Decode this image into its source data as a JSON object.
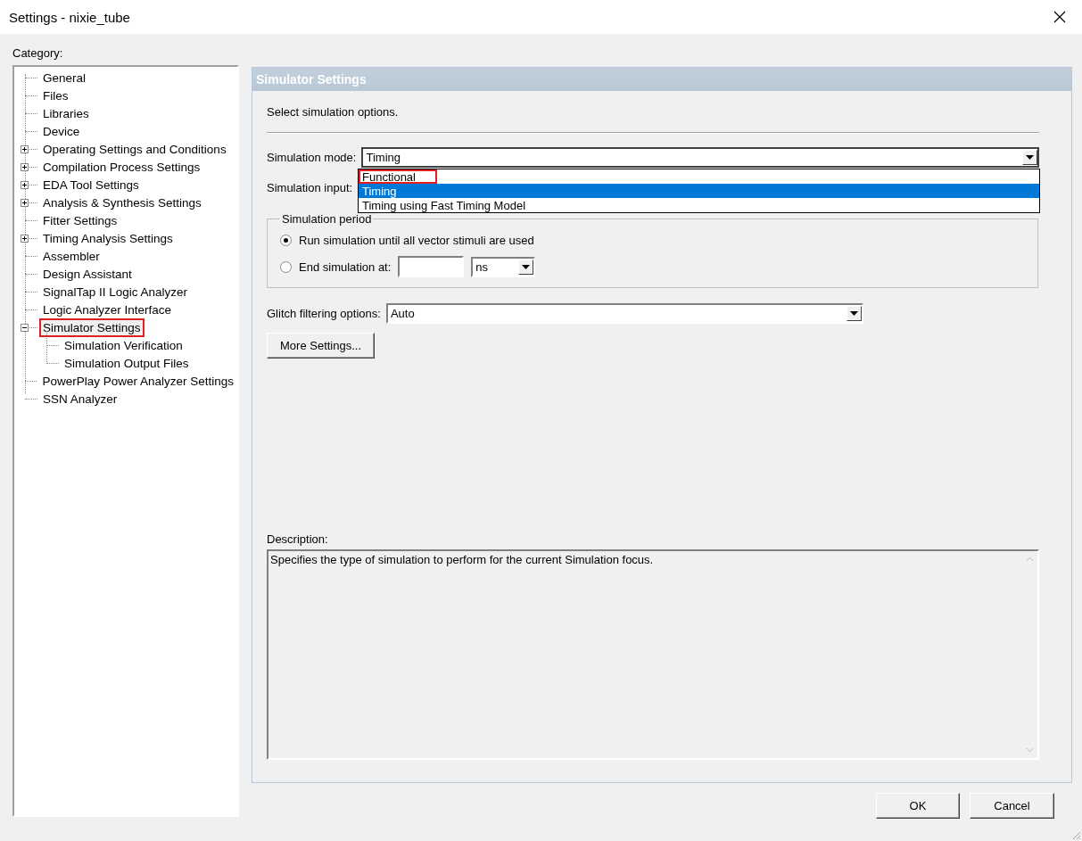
{
  "window": {
    "title": "Settings - nixie_tube"
  },
  "category": {
    "label": "Category:",
    "items": [
      {
        "label": "General",
        "selected": false,
        "annotated": false
      },
      {
        "label": "Files",
        "selected": false,
        "annotated": false
      },
      {
        "label": "Libraries",
        "selected": false,
        "annotated": false
      },
      {
        "label": "Device",
        "selected": false,
        "annotated": false
      },
      {
        "label": "Operating Settings and Conditions",
        "selected": false,
        "annotated": false,
        "expanded": false
      },
      {
        "label": "Compilation Process Settings",
        "selected": false,
        "annotated": false,
        "expanded": false
      },
      {
        "label": "EDA Tool Settings",
        "selected": false,
        "annotated": false,
        "expanded": false
      },
      {
        "label": "Analysis & Synthesis Settings",
        "selected": false,
        "annotated": false,
        "expanded": false
      },
      {
        "label": "Fitter Settings",
        "selected": false,
        "annotated": false
      },
      {
        "label": "Timing Analysis Settings",
        "selected": false,
        "annotated": false,
        "expanded": false
      },
      {
        "label": "Assembler",
        "selected": false,
        "annotated": false
      },
      {
        "label": "Design Assistant",
        "selected": false,
        "annotated": false
      },
      {
        "label": "SignalTap II Logic Analyzer",
        "selected": false,
        "annotated": false
      },
      {
        "label": "Logic Analyzer Interface",
        "selected": false,
        "annotated": false
      },
      {
        "label": "Simulator Settings",
        "selected": true,
        "annotated": true,
        "expanded": true,
        "children": [
          {
            "label": "Simulation Verification",
            "selected": false,
            "annotated": false
          },
          {
            "label": "Simulation Output Files",
            "selected": false,
            "annotated": false
          }
        ]
      },
      {
        "label": "PowerPlay Power Analyzer Settings",
        "selected": false,
        "annotated": false
      },
      {
        "label": "SSN Analyzer",
        "selected": false,
        "annotated": false
      }
    ]
  },
  "panel": {
    "title": "Simulator Settings",
    "intro": "Select simulation options.",
    "simulation_mode": {
      "label": "Simulation mode:",
      "value": "Timing",
      "open": true,
      "options": [
        {
          "label": "Functional",
          "selected": false,
          "annotated": true
        },
        {
          "label": "Timing",
          "selected": true,
          "annotated": false
        },
        {
          "label": "Timing using Fast Timing Model",
          "selected": false,
          "annotated": false
        }
      ]
    },
    "simulation_input": {
      "label": "Simulation input:"
    },
    "simulation_period": {
      "title": "Simulation period",
      "options": [
        {
          "label": "Run simulation until all vector stimuli are used",
          "selected": true
        },
        {
          "label": "End simulation at:",
          "selected": false
        }
      ],
      "unit": "ns"
    },
    "glitch": {
      "label": "Glitch filtering options:",
      "value": "Auto"
    },
    "more_button": "More Settings...",
    "description": {
      "label": "Description:",
      "text": "Specifies the type of simulation to perform for the current Simulation focus."
    }
  },
  "buttons": [
    "OK",
    "Cancel"
  ]
}
